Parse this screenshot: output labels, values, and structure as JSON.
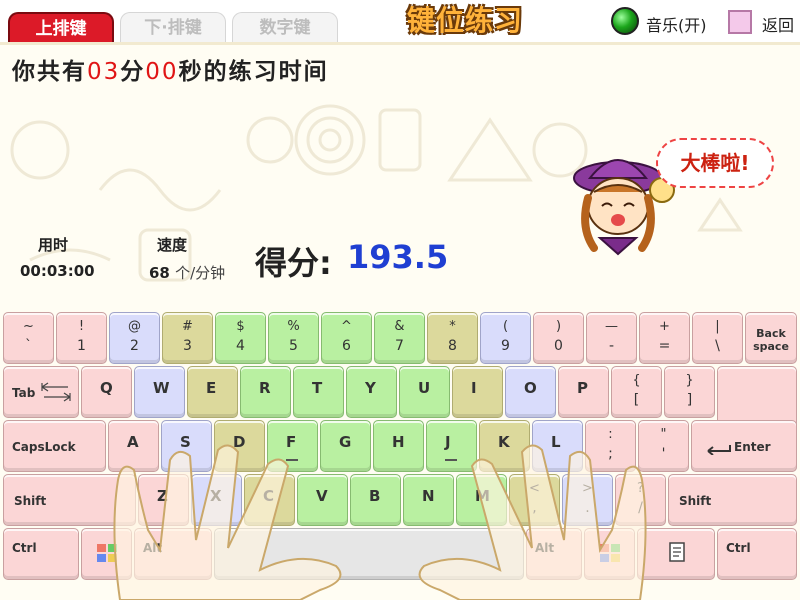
{
  "tabs": [
    {
      "label": "上排键",
      "active": true
    },
    {
      "label": "下·排键",
      "active": false
    },
    {
      "label": "数字键",
      "active": false
    }
  ],
  "app_title": "键位练习",
  "music": {
    "label": "音乐(开)",
    "icon": "music-toggle-icon"
  },
  "back": {
    "label": "返回",
    "icon": "back-square-icon"
  },
  "practice": {
    "prefix": "你共有",
    "minutes": "03",
    "minutes_unit": "分",
    "seconds": "00",
    "suffix": "秒的练习时间"
  },
  "stats": {
    "time_label": "用时",
    "time_value": "00:03:00",
    "speed_label": "速度",
    "speed_value": "68",
    "speed_unit": "个/分钟",
    "score_label": "得分:",
    "score_value": "193.5"
  },
  "mascot": {
    "bubble": "大棒啦!"
  },
  "colors": {
    "tab_active": "#dc1a28",
    "score": "#1f3fd2",
    "key_pink": "#fbd6d6",
    "key_blue": "#d9dcfb",
    "key_yellow": "#dcd99c",
    "key_green": "#b9f0a1"
  },
  "keyboard": {
    "row1": [
      {
        "top": "~",
        "bottom": "`",
        "color": "pink"
      },
      {
        "top": "!",
        "bottom": "1",
        "color": "pink"
      },
      {
        "top": "@",
        "bottom": "2",
        "color": "blue"
      },
      {
        "top": "#",
        "bottom": "3",
        "color": "yellow"
      },
      {
        "top": "$",
        "bottom": "4",
        "color": "green"
      },
      {
        "top": "%",
        "bottom": "5",
        "color": "green"
      },
      {
        "top": "^",
        "bottom": "6",
        "color": "green"
      },
      {
        "top": "&",
        "bottom": "7",
        "color": "green"
      },
      {
        "top": "*",
        "bottom": "8",
        "color": "yellow"
      },
      {
        "top": "(",
        "bottom": "9",
        "color": "blue"
      },
      {
        "top": ")",
        "bottom": "0",
        "color": "pink"
      },
      {
        "top": "—",
        "bottom": "-",
        "color": "pink"
      },
      {
        "top": "+",
        "bottom": "=",
        "color": "pink"
      },
      {
        "top": "|",
        "bottom": "\\",
        "color": "pink"
      },
      {
        "label": "Back space",
        "color": "pink"
      }
    ],
    "row2": [
      {
        "label": "Tab",
        "color": "pink"
      },
      {
        "label": "Q",
        "color": "pink"
      },
      {
        "label": "W",
        "color": "blue"
      },
      {
        "label": "E",
        "color": "yellow"
      },
      {
        "label": "R",
        "color": "green"
      },
      {
        "label": "T",
        "color": "green"
      },
      {
        "label": "Y",
        "color": "green"
      },
      {
        "label": "U",
        "color": "green"
      },
      {
        "label": "I",
        "color": "yellow"
      },
      {
        "label": "O",
        "color": "blue"
      },
      {
        "label": "P",
        "color": "pink"
      },
      {
        "top": "{",
        "bottom": "[",
        "color": "pink"
      },
      {
        "top": "}",
        "bottom": "]",
        "color": "pink"
      }
    ],
    "row3": [
      {
        "label": "CapsLock",
        "color": "pink"
      },
      {
        "label": "A",
        "color": "pink"
      },
      {
        "label": "S",
        "color": "blue"
      },
      {
        "label": "D",
        "color": "yellow"
      },
      {
        "label": "F",
        "color": "green"
      },
      {
        "label": "G",
        "color": "green"
      },
      {
        "label": "H",
        "color": "green"
      },
      {
        "label": "J",
        "color": "green"
      },
      {
        "label": "K",
        "color": "yellow"
      },
      {
        "label": "L",
        "color": "blue"
      },
      {
        "top": ":",
        "bottom": ";",
        "color": "pink"
      },
      {
        "top": "\"",
        "bottom": "'",
        "color": "pink"
      },
      {
        "label": "Enter",
        "color": "pink"
      }
    ],
    "row4": [
      {
        "label": "Shift",
        "color": "pink"
      },
      {
        "label": "Z",
        "color": "pink"
      },
      {
        "label": "X",
        "color": "blue"
      },
      {
        "label": "C",
        "color": "yellow"
      },
      {
        "label": "V",
        "color": "green"
      },
      {
        "label": "B",
        "color": "green"
      },
      {
        "label": "N",
        "color": "green"
      },
      {
        "label": "M",
        "color": "green"
      },
      {
        "top": "<",
        "bottom": ",",
        "color": "yellow"
      },
      {
        "top": ">",
        "bottom": ".",
        "color": "blue"
      },
      {
        "top": "?",
        "bottom": "/",
        "color": "pink"
      },
      {
        "label": "Shift",
        "color": "pink"
      }
    ],
    "row5": [
      {
        "label": "Ctrl",
        "color": "pink"
      },
      {
        "label": "Alt",
        "color": "pink"
      },
      {
        "label": "",
        "color": "gray"
      },
      {
        "label": "Alt",
        "color": "pink"
      },
      {
        "label": "Ctrl",
        "color": "pink"
      }
    ]
  }
}
